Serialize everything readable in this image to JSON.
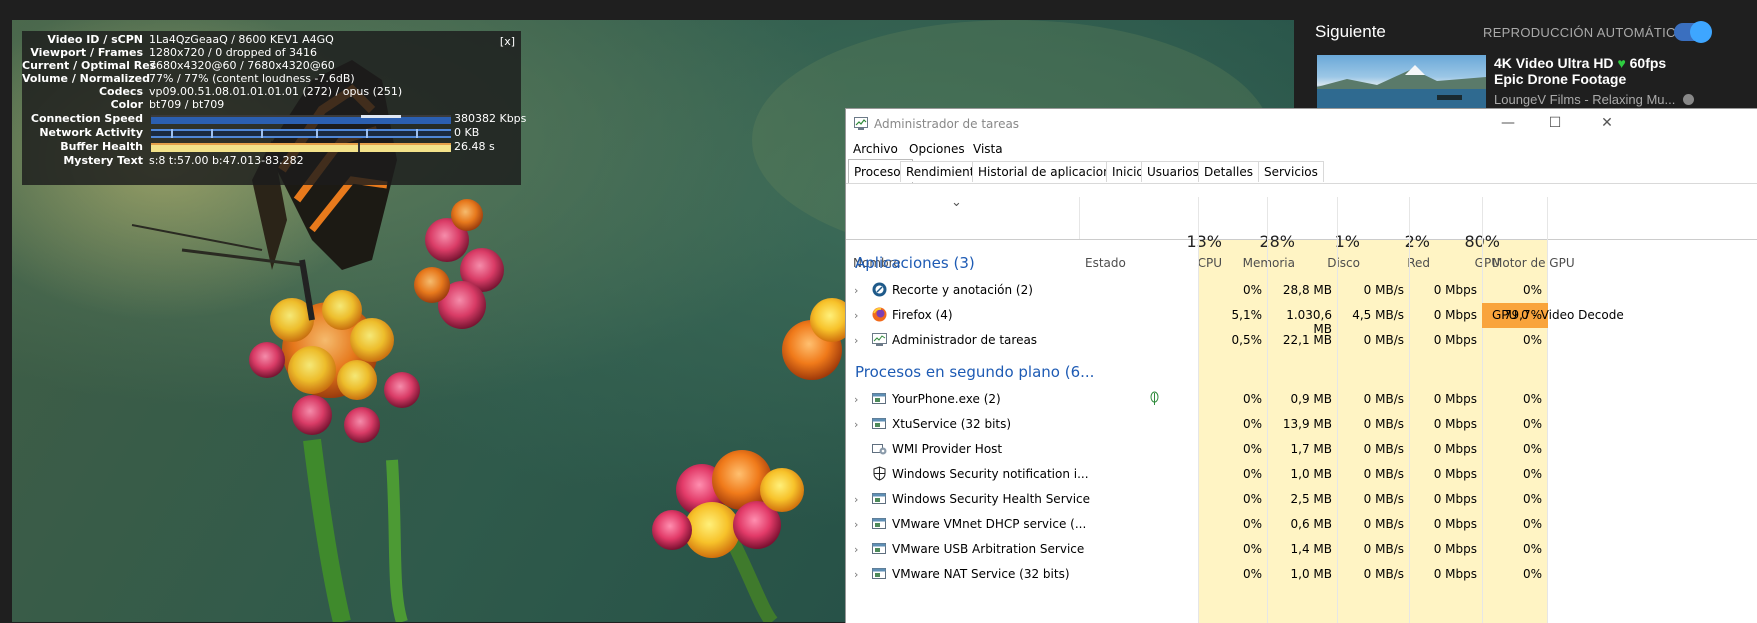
{
  "stats_overlay": {
    "close_label": "[x]",
    "rows": [
      {
        "label": "Video ID / sCPN",
        "value": "1La4QzGeaaQ / 8600 KEV1 A4GQ"
      },
      {
        "label": "Viewport / Frames",
        "value": "1280x720 / 0 dropped of 3416"
      },
      {
        "label": "Current / Optimal Res",
        "value": "7680x4320@60 / 7680x4320@60"
      },
      {
        "label": "Volume / Normalized",
        "value": "77% / 77% (content loudness -7.6dB)"
      },
      {
        "label": "Codecs",
        "value": "vp09.00.51.08.01.01.01.01 (272) / opus (251)"
      },
      {
        "label": "Color",
        "value": "bt709 / bt709"
      },
      {
        "label": "Connection Speed",
        "value": "380382 Kbps"
      },
      {
        "label": "Network Activity",
        "value": "0 KB"
      },
      {
        "label": "Buffer Health",
        "value": "26.48 s"
      },
      {
        "label": "Mystery Text",
        "value": "s:8 t:57.00 b:47.013-83.282"
      }
    ]
  },
  "sidebar": {
    "next_title": "Siguiente",
    "autoplay_label": "REPRODUCCIÓN AUTOMÁTICA",
    "autoplay_on": true,
    "rec_title_1": "4K Video Ultra HD",
    "rec_heart": "♥",
    "rec_title_2": "60fps",
    "rec_title_3": "Epic Drone Footage",
    "rec_channel": "LoungeV Films - Relaxing Mu..."
  },
  "taskmanager": {
    "title": "Administrador de tareas",
    "menu": [
      "Archivo",
      "Opciones",
      "Vista"
    ],
    "tabs": [
      "Procesos",
      "Rendimiento",
      "Historial de aplicaciones",
      "Inicio",
      "Usuarios",
      "Detalles",
      "Servicios"
    ],
    "active_tab": "Procesos",
    "sort_glyph": "⌄",
    "columns": {
      "name": "Nombre",
      "status": "Estado",
      "cpu": {
        "pct": "13%",
        "label": "CPU"
      },
      "mem": {
        "pct": "28%",
        "label": "Memoria"
      },
      "disk": {
        "pct": "1%",
        "label": "Disco"
      },
      "net": {
        "pct": "2%",
        "label": "Red"
      },
      "gpu": {
        "pct": "80%",
        "label": "GPU"
      },
      "engine": "Motor de GPU"
    },
    "groups": {
      "apps": "Aplicaciones (3)",
      "background": "Procesos en segundo plano (6..."
    },
    "apps": [
      {
        "name": "Recorte y anotación (2)",
        "cpu": "0%",
        "mem": "28,8 MB",
        "disk": "0 MB/s",
        "net": "0 Mbps",
        "gpu": "0%",
        "engine": "",
        "icon": "snip-icon"
      },
      {
        "name": "Firefox (4)",
        "cpu": "5,1%",
        "mem": "1.030,6 MB",
        "disk": "4,5 MB/s",
        "net": "0 Mbps",
        "gpu": "79,7%",
        "engine": "GPU 0 - Video Decode",
        "icon": "firefox-icon"
      },
      {
        "name": "Administrador de tareas",
        "cpu": "0,5%",
        "mem": "22,1 MB",
        "disk": "0 MB/s",
        "net": "0 Mbps",
        "gpu": "0%",
        "engine": "",
        "icon": "taskmgr-icon"
      }
    ],
    "background": [
      {
        "name": "YourPhone.exe (2)",
        "cpu": "0%",
        "mem": "0,9 MB",
        "disk": "0 MB/s",
        "net": "0 Mbps",
        "gpu": "0%",
        "icon": "window-icon",
        "expandable": true
      },
      {
        "name": "XtuService (32 bits)",
        "cpu": "0%",
        "mem": "13,9 MB",
        "disk": "0 MB/s",
        "net": "0 Mbps",
        "gpu": "0%",
        "icon": "window-icon",
        "expandable": true
      },
      {
        "name": "WMI Provider Host",
        "cpu": "0%",
        "mem": "1,7 MB",
        "disk": "0 MB/s",
        "net": "0 Mbps",
        "gpu": "0%",
        "icon": "service-icon",
        "expandable": false
      },
      {
        "name": "Windows Security notification i...",
        "cpu": "0%",
        "mem": "1,0 MB",
        "disk": "0 MB/s",
        "net": "0 Mbps",
        "gpu": "0%",
        "icon": "shield-icon",
        "expandable": false
      },
      {
        "name": "Windows Security Health Service",
        "cpu": "0%",
        "mem": "2,5 MB",
        "disk": "0 MB/s",
        "net": "0 Mbps",
        "gpu": "0%",
        "icon": "window-icon",
        "expandable": true
      },
      {
        "name": "VMware VMnet DHCP service (...",
        "cpu": "0%",
        "mem": "0,6 MB",
        "disk": "0 MB/s",
        "net": "0 Mbps",
        "gpu": "0%",
        "icon": "window-icon",
        "expandable": true
      },
      {
        "name": "VMware USB Arbitration Service",
        "cpu": "0%",
        "mem": "1,4 MB",
        "disk": "0 MB/s",
        "net": "0 Mbps",
        "gpu": "0%",
        "icon": "window-icon",
        "expandable": true
      },
      {
        "name": "VMware NAT Service (32 bits)",
        "cpu": "0%",
        "mem": "1,0 MB",
        "disk": "0 MB/s",
        "net": "0 Mbps",
        "gpu": "0%",
        "icon": "window-icon",
        "expandable": true
      }
    ]
  }
}
